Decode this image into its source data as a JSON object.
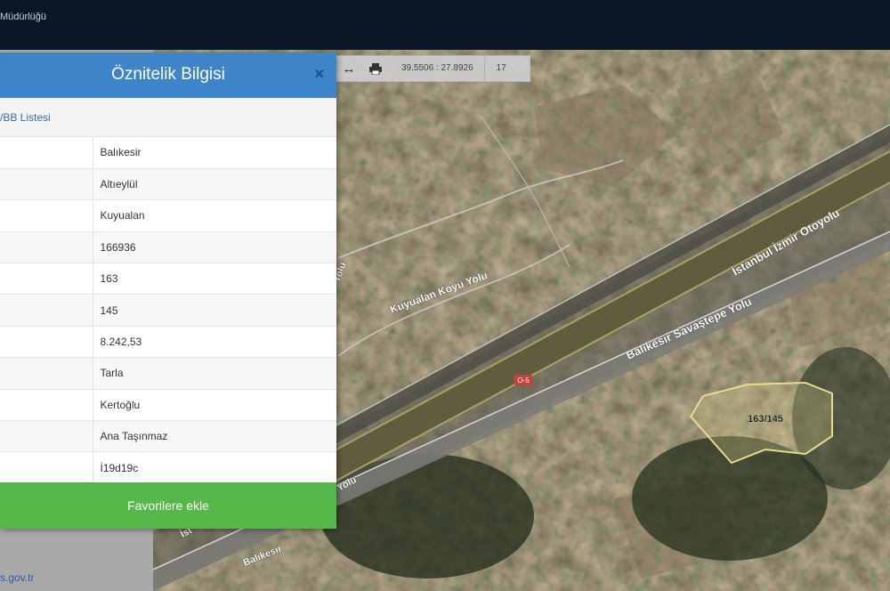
{
  "header": {
    "title": "Müdürlüğü"
  },
  "toolbar": {
    "coords": "39.5506 : 27.8926",
    "zoom": "17"
  },
  "popup": {
    "title": "Öznitelik Bilgisi",
    "close_label": "×",
    "list_link": "/BB Listesi",
    "rows": [
      {
        "value": "Balıkesir"
      },
      {
        "value": "Altıeylül"
      },
      {
        "value": "Kuyualan"
      },
      {
        "value": "166936"
      },
      {
        "value": "163"
      },
      {
        "value": "145"
      },
      {
        "value": "8.242,53"
      },
      {
        "value": "Tarla"
      },
      {
        "value": "Kertoğlu"
      },
      {
        "value": "Ana Taşınmaz"
      },
      {
        "value": "İ19d19c"
      }
    ],
    "favorite_button": "Favorilere ekle"
  },
  "footer": {
    "link": "s.gov.tr"
  },
  "map": {
    "roads": {
      "istanbul_izmir": "İstanbul İzmir Otoyolu",
      "savastepe": "Balıkesir Savaştepe Yolu",
      "kuyualan": "Kuyualan Köyü Yolu",
      "road_label_o5": "O-5",
      "fragment_yolu_left": "Yolu",
      "fragment_yolu_bottom": "Yolu",
      "fragment_st": "İst",
      "fragment_balikesir_bottom": "Balıkesir"
    },
    "parcel_label": "163/145"
  }
}
